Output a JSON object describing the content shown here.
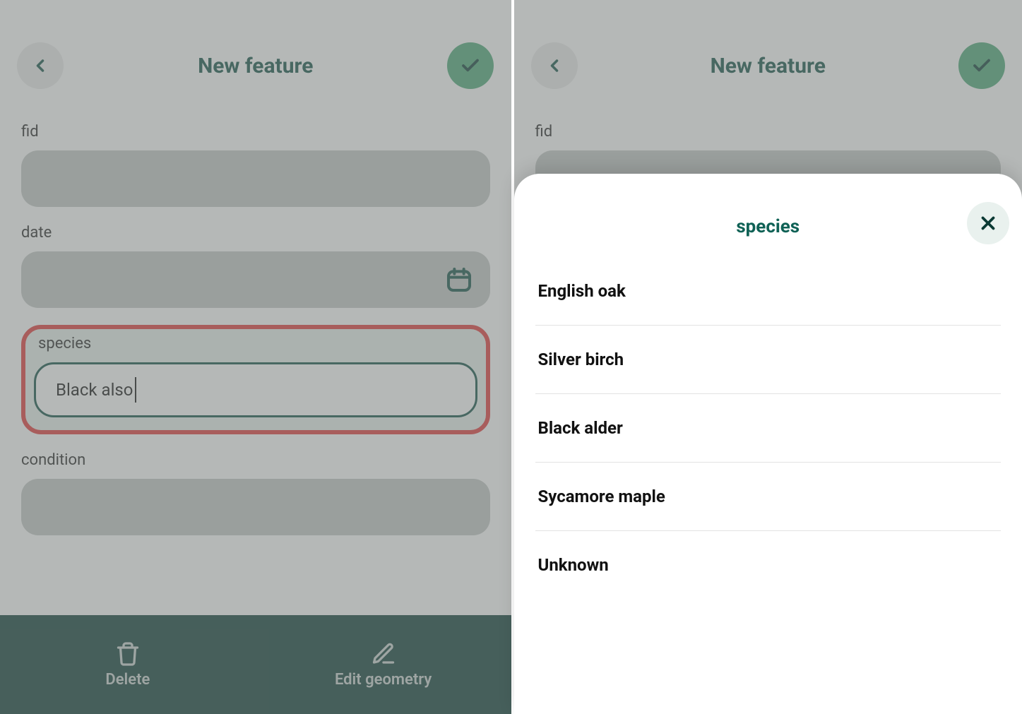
{
  "header": {
    "title": "New feature"
  },
  "form": {
    "fid_label": "fid",
    "fid_value": "",
    "date_label": "date",
    "date_value": "",
    "species_label": "species",
    "species_value": "Black also",
    "condition_label": "condition",
    "condition_value": ""
  },
  "toolbar": {
    "delete_label": "Delete",
    "edit_geometry_label": "Edit geometry"
  },
  "dropdown": {
    "title": "species",
    "options": [
      "English oak",
      "Silver birch",
      "Black alder",
      "Sycamore maple",
      "Unknown"
    ]
  },
  "colors": {
    "accent_dark": "#0f4e44",
    "accent_green": "#4aa775",
    "bottom_bar": "#0b3a34",
    "highlight_border": "#e23737"
  }
}
